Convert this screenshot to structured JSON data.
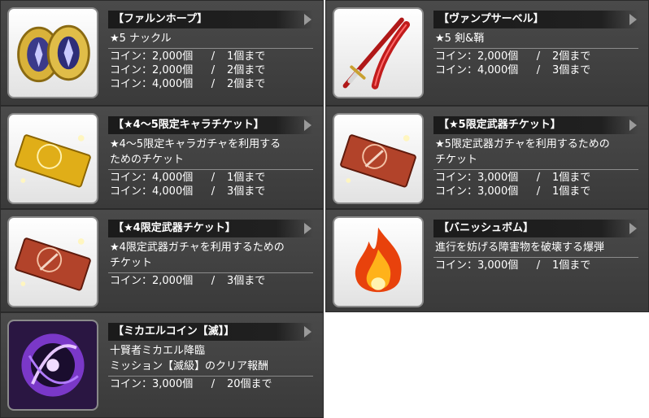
{
  "items": [
    {
      "icon": "falun-hope-knuckle-icon",
      "title": "【ファルンホープ】",
      "desc": [
        "★5 ナックル"
      ],
      "costs": [
        {
          "price": "コイン：2,000個",
          "sep": "/",
          "limit": "1個まで"
        },
        {
          "price": "コイン：2,000個",
          "sep": "/",
          "limit": "2個まで"
        },
        {
          "price": "コイン：4,000個",
          "sep": "/",
          "limit": "2個まで"
        }
      ]
    },
    {
      "icon": "vamp-saber-sword-icon",
      "title": "【ヴァンプサーベル】",
      "desc": [
        "★5 剣&鞘"
      ],
      "costs": [
        {
          "price": "コイン：2,000個",
          "sep": "/",
          "limit": "2個まで"
        },
        {
          "price": "コイン：4,000個",
          "sep": "/",
          "limit": "3個まで"
        }
      ]
    },
    {
      "icon": "gold-character-ticket-icon",
      "title": "【★4～5限定キャラチケット】",
      "desc": [
        "★4～5限定キャラガチャを利用する",
        "ためのチケット"
      ],
      "costs": [
        {
          "price": "コイン：4,000個",
          "sep": "/",
          "limit": "1個まで"
        },
        {
          "price": "コイン：4,000個",
          "sep": "/",
          "limit": "3個まで"
        }
      ]
    },
    {
      "icon": "red-weapon-ticket-icon",
      "title": "【★5限定武器チケット】",
      "desc": [
        "★5限定武器ガチャを利用するための",
        "チケット"
      ],
      "costs": [
        {
          "price": "コイン：3,000個",
          "sep": "/",
          "limit": "1個まで"
        },
        {
          "price": "コイン：3,000個",
          "sep": "/",
          "limit": "1個まで"
        }
      ]
    },
    {
      "icon": "red-weapon-ticket-icon",
      "title": "【★4限定武器チケット】",
      "desc": [
        "★4限定武器ガチャを利用するための",
        "チケット"
      ],
      "costs": [
        {
          "price": "コイン：2,000個",
          "sep": "/",
          "limit": "3個まで"
        }
      ]
    },
    {
      "icon": "vanish-bomb-flame-icon",
      "title": "【バニッシュボム】",
      "desc": [
        "進行を妨げる障害物を破壊する爆弾"
      ],
      "costs": [
        {
          "price": "コイン：3,000個",
          "sep": "/",
          "limit": "1個まで"
        }
      ]
    },
    {
      "icon": "michael-coin-purple-icon",
      "title": "【ミカエルコイン【滅】】",
      "desc": [
        "十賢者ミカエル降臨",
        "ミッション【滅級】のクリア報酬"
      ],
      "costs": [
        {
          "price": "コイン：3,000個",
          "sep": "/",
          "limit": "20個まで"
        }
      ]
    }
  ]
}
